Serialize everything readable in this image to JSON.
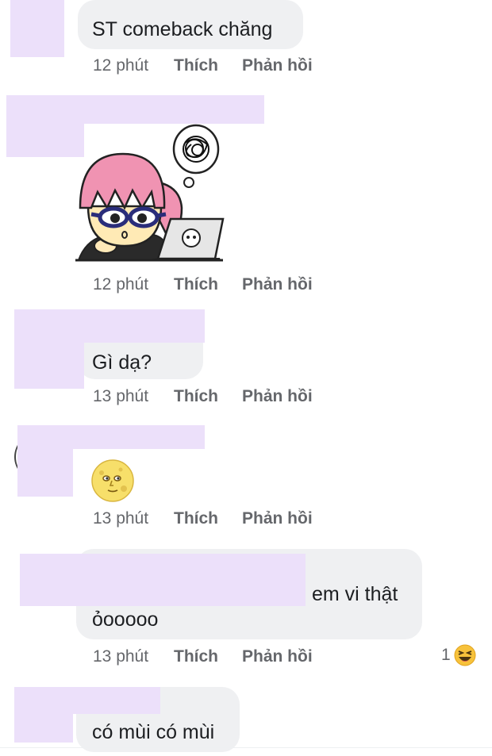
{
  "comments": [
    {
      "text": "ST comeback chăng",
      "time": "12 phút",
      "like": "Thích",
      "reply": "Phản hồi"
    },
    {
      "sticker": "girl-laptop-sticker",
      "time": "12 phút",
      "like": "Thích",
      "reply": "Phản hồi"
    },
    {
      "text": "Gì dạ?",
      "time": "13 phút",
      "like": "Thích",
      "reply": "Phản hồi"
    },
    {
      "emoji": "moon-face-emoji",
      "time": "13 phút",
      "like": "Thích",
      "reply": "Phản hồi"
    },
    {
      "line1": "em vi thật",
      "line2": "ỏooooo",
      "time": "13 phút",
      "like": "Thích",
      "reply": "Phản hồi",
      "reaction_count": "1",
      "reaction_icon": "laughing-emoji"
    },
    {
      "text": "có mùi có mùi"
    }
  ],
  "colors": {
    "redaction": "#ece0fa",
    "bubble": "#eff0f2",
    "meta": "#65676b",
    "text": "#1c1e21"
  }
}
